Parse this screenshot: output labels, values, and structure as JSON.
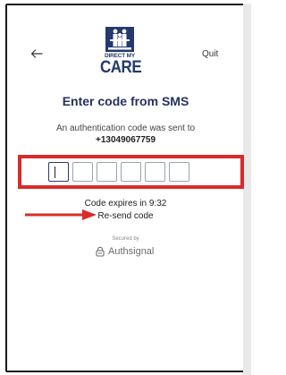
{
  "header": {
    "back_icon": "arrow-left-icon",
    "quit_label": "Quit"
  },
  "logo": {
    "line1": "DIRECT MY",
    "line2": "CARE",
    "color": "#243a6e"
  },
  "main": {
    "title": "Enter code from SMS",
    "sent_message": "An authentication code was sent to",
    "phone_number": "+13049067759",
    "code_length": 6,
    "expires_text": "Code expires in 9:32",
    "resend_label": "Re-send code"
  },
  "footer": {
    "secured_by": "Secured by",
    "brand": "Authsignal",
    "brand_icon": "authsignal-logo-icon"
  },
  "annotations": {
    "highlight_color": "#d92b2b",
    "arrow_icon": "red-arrow-right-icon"
  }
}
